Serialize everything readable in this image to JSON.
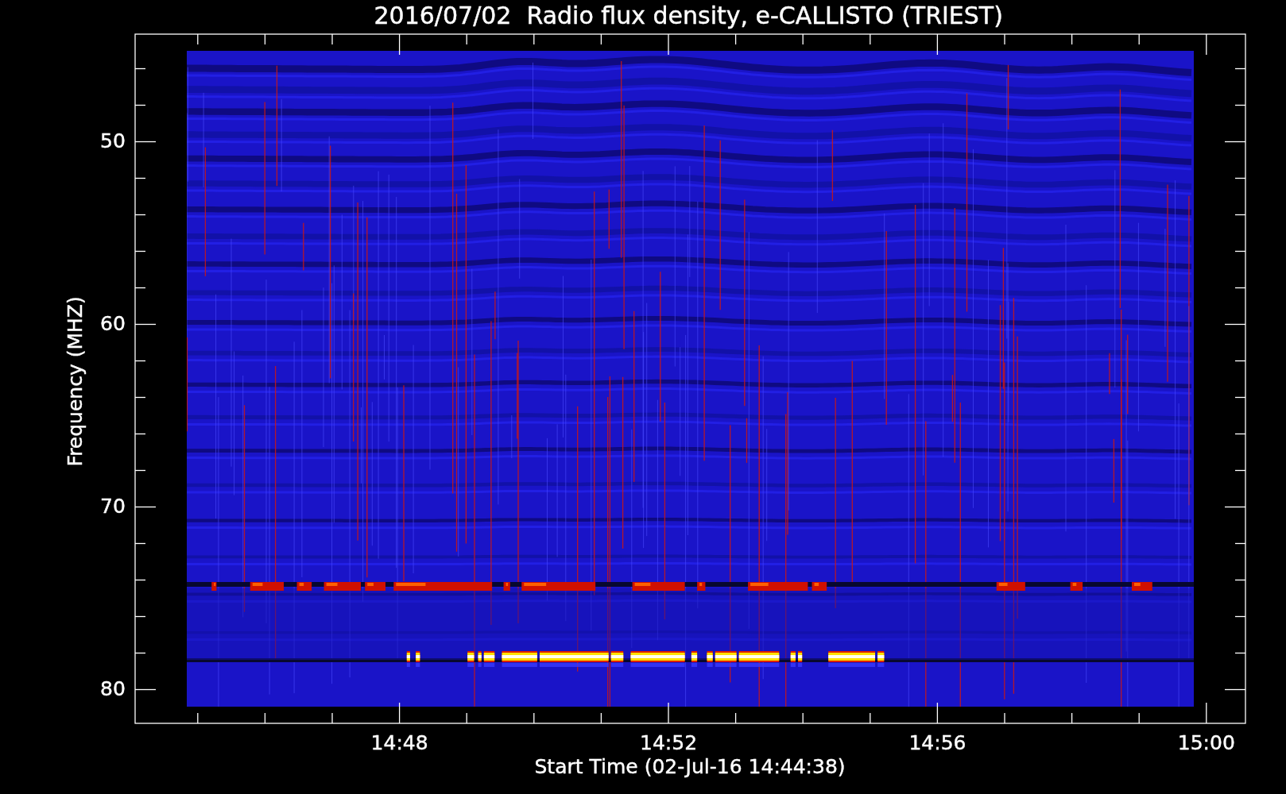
{
  "title": "2016/07/02  Radio flux density, e-CALLISTO (TRIEST)",
  "ylabel": "Frequency (MHZ)",
  "xlabel": "Start Time (02-Jul-16 14:44:38)",
  "yticks": [
    "50",
    "60",
    "70",
    "80"
  ],
  "xticks": [
    "14:48",
    "14:52",
    "14:56",
    "15:00"
  ]
}
